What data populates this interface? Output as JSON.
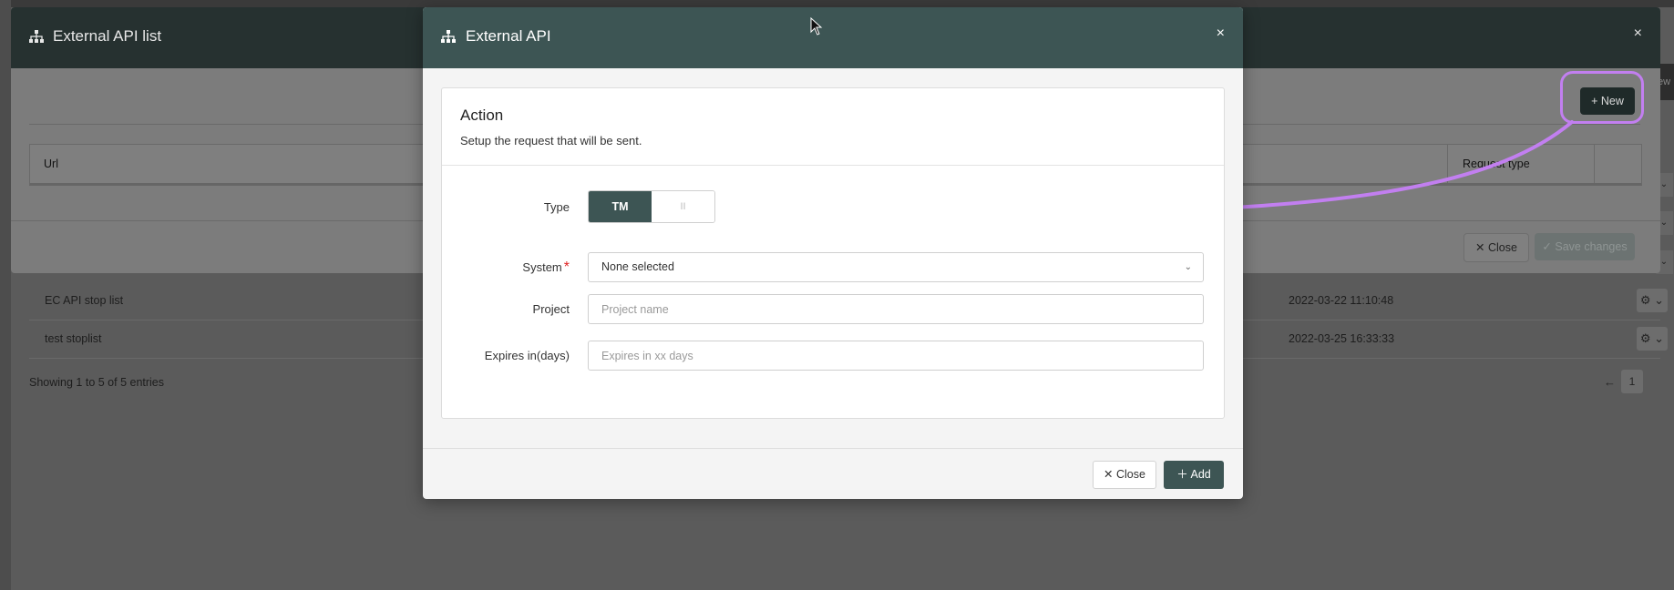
{
  "background_page": {
    "side_label": "ew",
    "rows": [
      {
        "name": "EC API stop list",
        "date": "2022-03-22 11:10:48"
      },
      {
        "name": "test stoplist",
        "date": "2022-03-25 16:33:33"
      }
    ],
    "row_action_icon": "gear-icon",
    "info": "Showing 1 to 5 of 5 entries",
    "pager": {
      "prev": "←",
      "current": "1"
    }
  },
  "list_modal": {
    "title": "External API list",
    "title_icon": "sitemap-icon",
    "close_symbol": "×",
    "new_button": "+ New",
    "columns": [
      "Url",
      "Request type"
    ],
    "close_button": "Close",
    "save_button": "Save changes"
  },
  "api_modal": {
    "title": "External API",
    "title_icon": "sitemap-icon",
    "close_symbol": "×",
    "section": {
      "title": "Action",
      "subtitle": "Setup the request that will be sent."
    },
    "type": {
      "label": "Type",
      "options": [
        "TM",
        "II"
      ],
      "selected": "TM"
    },
    "system": {
      "label": "System",
      "required_marker": "*",
      "value": "None selected"
    },
    "project": {
      "label": "Project",
      "placeholder": "Project name"
    },
    "expires": {
      "label": "Expires in(days)",
      "placeholder": "Expires in xx days"
    },
    "close_button": "Close",
    "add_button": "Add"
  },
  "annotation": {
    "highlight_color": "#c27ff0"
  },
  "colors": {
    "primary": "#3d5554",
    "required": "#e02424"
  }
}
